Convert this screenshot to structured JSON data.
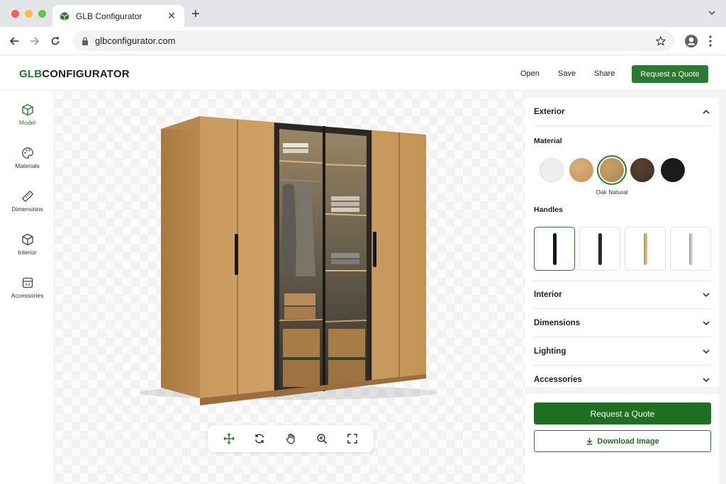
{
  "browser": {
    "tab_title": "GLB Configurator",
    "url": "glbconfigurator.com"
  },
  "header": {
    "logo_part1": "GLB",
    "logo_part2": "CONFIGURATOR",
    "links": [
      "Open",
      "Save",
      "Share"
    ],
    "cta": "Request a Quote"
  },
  "rail": {
    "items": [
      {
        "label": "Model",
        "icon": "cube-icon",
        "active": true
      },
      {
        "label": "Materials",
        "icon": "palette-icon",
        "active": false
      },
      {
        "label": "Dimensions",
        "icon": "ruler-icon",
        "active": false
      },
      {
        "label": "Interior",
        "icon": "box-icon",
        "active": false
      },
      {
        "label": "Accessories",
        "icon": "accessories-icon",
        "active": false
      }
    ]
  },
  "panel": {
    "exterior": {
      "title": "Exterior",
      "material_label": "Material",
      "swatches": [
        {
          "color": "#eeeeee",
          "selected": false
        },
        {
          "color": "#c9a06a",
          "selected": false
        },
        {
          "color": "#b8905a",
          "selected": true
        },
        {
          "color": "#4a3526",
          "selected": false
        },
        {
          "color": "#1b1b1b",
          "selected": false
        }
      ],
      "selected_material": "Oak Natural",
      "handles_label": "Handles",
      "handles": [
        {
          "color": "#161616",
          "selected": true
        },
        {
          "color": "#2a2a2a",
          "selected": false
        },
        {
          "color": "#cfae7c",
          "selected": false
        },
        {
          "color": "#b9b9b9",
          "selected": false
        }
      ]
    },
    "sections": [
      "Interior",
      "Dimensions",
      "Lighting",
      "Accessories"
    ],
    "primary_button": "Request a Quote",
    "secondary_button": "Download Image"
  },
  "viewer": {
    "controls": [
      "move-icon",
      "rotate-icon",
      "pan-hand-icon",
      "zoom-in-icon",
      "fullscreen-icon"
    ]
  },
  "colors": {
    "brand_green": "#2a7a2f",
    "dark_green": "#1f6f23",
    "oak": "#c18f55"
  }
}
